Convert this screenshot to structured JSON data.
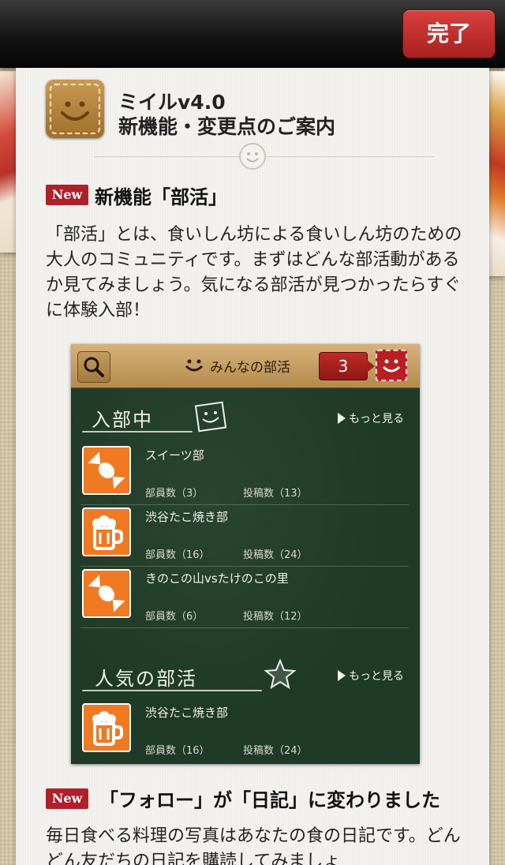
{
  "topbar": {
    "done_label": "完了"
  },
  "header": {
    "app_name": "ミイルv4.0",
    "subtitle": "新機能・変更点のご案内"
  },
  "sections": [
    {
      "badge": "New",
      "title": "新機能「部活」",
      "body": "「部活」とは、食いしん坊による食いしん坊のための大人のコミュニティです。まずはどんな部活動があるか見てみましょう。気になる部活が見つかったらすぐに体験入部！"
    },
    {
      "badge": "New",
      "title": "「フォロー」が「日記」に変わりました",
      "body": "毎日食べる料理の写真はあなたの食の日記です。どんどん友だちの日記を購読してみましょ"
    }
  ],
  "screenshot": {
    "header_title": "みんなの部活",
    "count": "3",
    "joined_heading": "入部中",
    "popular_heading": "人気の部活",
    "more_label": "もっと見る",
    "joined_clubs": [
      {
        "name": "スイーツ部",
        "members": "部員数（3）",
        "posts": "投稿数（13）",
        "icon": "candy-icon"
      },
      {
        "name": "渋谷たこ焼き部",
        "members": "部員数（16）",
        "posts": "投稿数（24）",
        "icon": "beer-icon"
      },
      {
        "name": "きのこの山vsたけのこの里",
        "members": "部員数（6）",
        "posts": "投稿数（12）",
        "icon": "candy-icon"
      }
    ],
    "popular_clubs": [
      {
        "name": "渋谷たこ焼き部",
        "members": "部員数（16）",
        "posts": "投稿数（24）",
        "icon": "beer-icon"
      }
    ]
  },
  "colors": {
    "accent_red": "#b0202a",
    "board_green": "#1f3a27",
    "club_orange": "#ef7a22"
  }
}
